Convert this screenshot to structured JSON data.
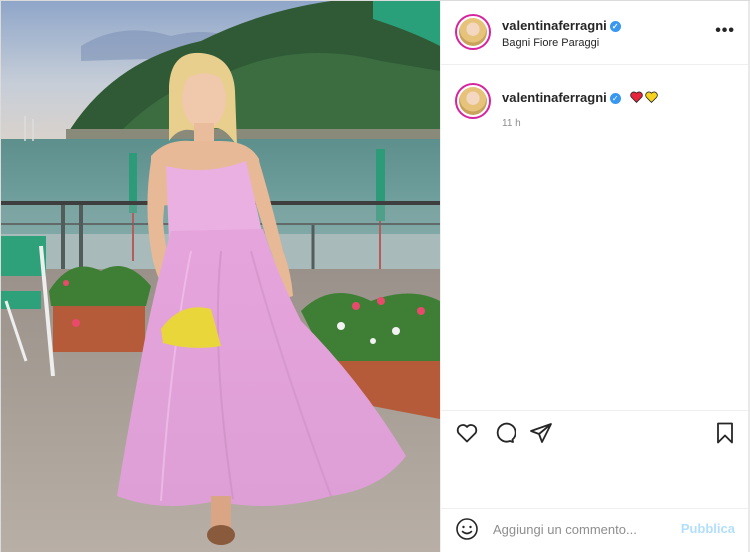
{
  "post": {
    "username": "valentinaferragni",
    "verified": true,
    "location": "Bagni Fiore Paraggi",
    "more_icon": "more-horizontal-icon"
  },
  "caption": {
    "username": "valentinaferragni",
    "emojis": [
      "heart-red-icon",
      "heart-yellow-icon"
    ],
    "time": "11 h"
  },
  "actions": {
    "icons": [
      "heart-icon",
      "comment-icon",
      "share-icon",
      "bookmark-icon"
    ]
  },
  "comment": {
    "placeholder": "Aggiungi un commento...",
    "publish_label": "Pubblica",
    "emoji_icon": "smiley-icon"
  },
  "colors": {
    "verified": "#3897f0",
    "publish_disabled": "#b2dffc",
    "avatar_ring": "#d6249f",
    "dress": "#e9a9de"
  }
}
